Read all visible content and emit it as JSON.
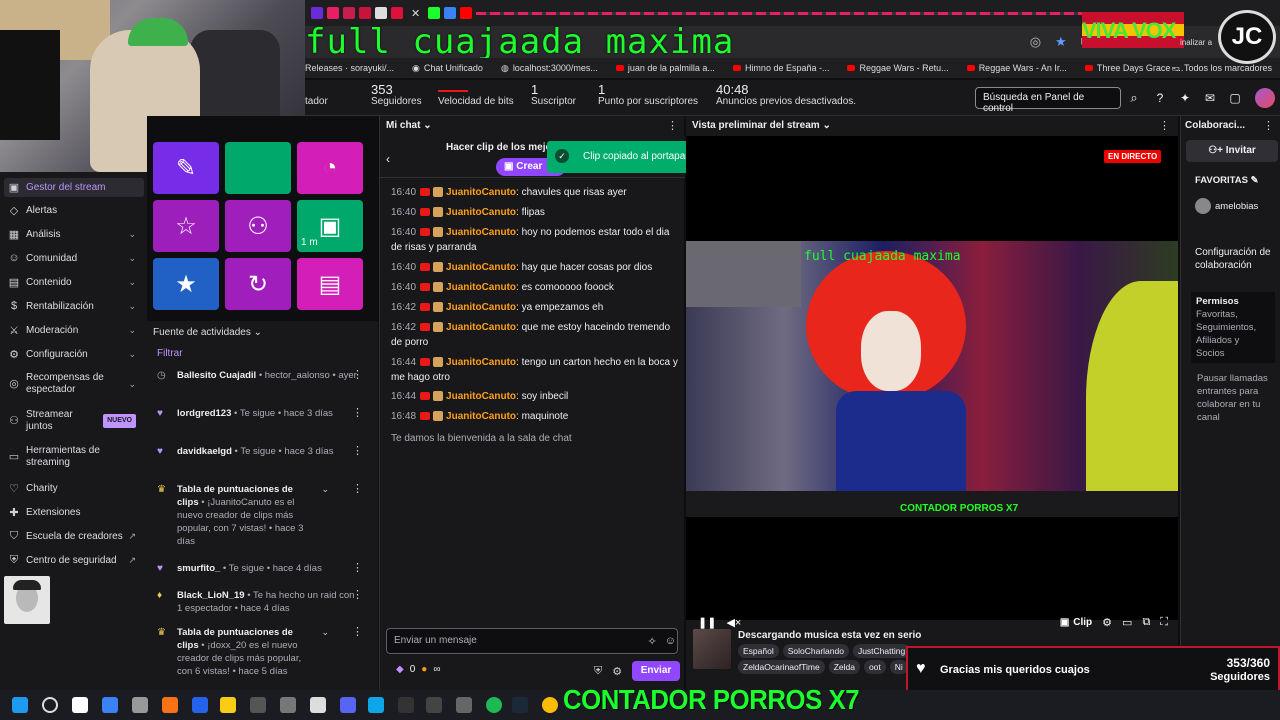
{
  "overlay": {
    "title": "full cuajaada maxima",
    "counter": "CONTADOR PORROS X7",
    "viva": "VIVA VOX",
    "logo": "JC",
    "finalizar": "inalizar a"
  },
  "bookmarks": [
    "Releases · sorayuki/...",
    "Chat Unificado",
    "localhost:3000/mes...",
    "juan de la palmilla a...",
    "Himno de España -...",
    "Reggae Wars - Retu...",
    "Reggae Wars - An Ir...",
    "Three Days Grace -..."
  ],
  "bookmarks_all": "Todos los marcadores",
  "stats": {
    "partial_label": "tador",
    "followers_value": "353",
    "followers_label": "Seguidores",
    "bitrate_label": "Velocidad de bits",
    "subs_value": "1",
    "subs_label": "Suscriptor",
    "sub_points_value": "1",
    "sub_points_label": "Punto por suscriptores",
    "ads_value": "40:48",
    "ads_label": "Anuncios previos desactivados.",
    "search_placeholder": "Búsqueda en Panel de control"
  },
  "sidebar": {
    "items": [
      {
        "label": "Gestor del stream"
      },
      {
        "label": "Alertas"
      },
      {
        "label": "Análisis"
      },
      {
        "label": "Comunidad"
      },
      {
        "label": "Contenido"
      },
      {
        "label": "Rentabilización"
      },
      {
        "label": "Moderación"
      },
      {
        "label": "Configuración"
      },
      {
        "label": "Recompensas de espectador"
      },
      {
        "label": "Streamear juntos"
      },
      {
        "label": "Herramientas de streaming"
      },
      {
        "label": "Charity"
      },
      {
        "label": "Extensiones"
      },
      {
        "label": "Escuela de creadores"
      },
      {
        "label": "Centro de seguridad"
      }
    ],
    "badge_new": "NUEVO"
  },
  "quick_actions": {
    "tile_timer": "1 m"
  },
  "feed": {
    "title": "Fuente de actividades",
    "filter": "Filtrar",
    "items": [
      {
        "user": "Ballesito Cuajadil",
        "text": " • hector_aalonso • ayer"
      },
      {
        "user": "lordgred123",
        "text": " • Te sigue • hace 3 días"
      },
      {
        "user": "davidkaelgd",
        "text": " • Te sigue • hace 3 días"
      },
      {
        "user": "Tabla de puntuaciones de clips",
        "text": " • ¡JuanitoCanuto es el nuevo creador de clips más popular, con 7 vistas! • hace 3 días"
      },
      {
        "user": "smurfito_",
        "text": " • Te sigue • hace 4 días"
      },
      {
        "user": "Black_LioN_19",
        "text": " • Te ha hecho un raid con 1 espectador • hace 4 días"
      },
      {
        "user": "Tabla de puntuaciones de clips",
        "text": " • ¡doxx_20 es el nuevo creador de clips más popular, con 6 vistas! • hace 5 días"
      }
    ]
  },
  "chat": {
    "title": "Mi chat",
    "clip_title": "Hacer clip de los mejor",
    "clip_button": "Crear",
    "toast": "Clip copiado al portapapeles.",
    "messages": [
      {
        "time": "16:40",
        "user": "JuanitoCanuto",
        "text": ": chavules que risas ayer"
      },
      {
        "time": "16:40",
        "user": "JuanitoCanuto",
        "text": ": flipas"
      },
      {
        "time": "16:40",
        "user": "JuanitoCanuto",
        "text": ": hoy no podemos estar todo el dia de risas y parranda"
      },
      {
        "time": "16:40",
        "user": "JuanitoCanuto",
        "text": ": hay que hacer cosas por dios"
      },
      {
        "time": "16:40",
        "user": "JuanitoCanuto",
        "text": ": es comooooo fooock"
      },
      {
        "time": "16:42",
        "user": "JuanitoCanuto",
        "text": ": ya empezamos eh"
      },
      {
        "time": "16:42",
        "user": "JuanitoCanuto",
        "text": ": que me estoy haceindo tremendo de porro"
      },
      {
        "time": "16:44",
        "user": "JuanitoCanuto",
        "text": ": tengo un carton hecho en la boca y me hago otro"
      },
      {
        "time": "16:44",
        "user": "JuanitoCanuto",
        "text": ": soy inbecil"
      },
      {
        "time": "16:48",
        "user": "JuanitoCanuto",
        "text": ": maquinote"
      }
    ],
    "welcome": "Te damos la bienvenida a la sala de chat",
    "input_placeholder": "Enviar un mensaje",
    "bits": "0",
    "send": "Enviar"
  },
  "preview": {
    "title": "Vista preliminar del stream",
    "live": "EN DIRECTO",
    "clip_label": "Clip",
    "stream_title": "Descargando musica esta vez en serio",
    "tags_row1": [
      "Español",
      "SoloCharlando",
      "JustChatting"
    ],
    "tags_row2": [
      "ZeldaOcarinaofTime",
      "Zelda",
      "oot",
      "Ni"
    ],
    "inner_title": "full cuajaada maxima",
    "inner_counter": "CONTADOR PORROS X7"
  },
  "collab": {
    "title": "Colaboraci...",
    "invite": "Invitar",
    "favorites": "FAVORITAS",
    "fav_user": "amelobias",
    "config_title": "Configuración de colaboración",
    "perm_title": "Permisos",
    "perm_text": "Favoritas, Seguimientos, Afiliados y Socios",
    "calls_text": "Pausar llamadas entrantes para colaborar en tu canal"
  },
  "goal": {
    "label": "Gracias mis queridos cuajos",
    "count": "353/360",
    "sub": "Seguidores",
    "progress": 0.98
  }
}
